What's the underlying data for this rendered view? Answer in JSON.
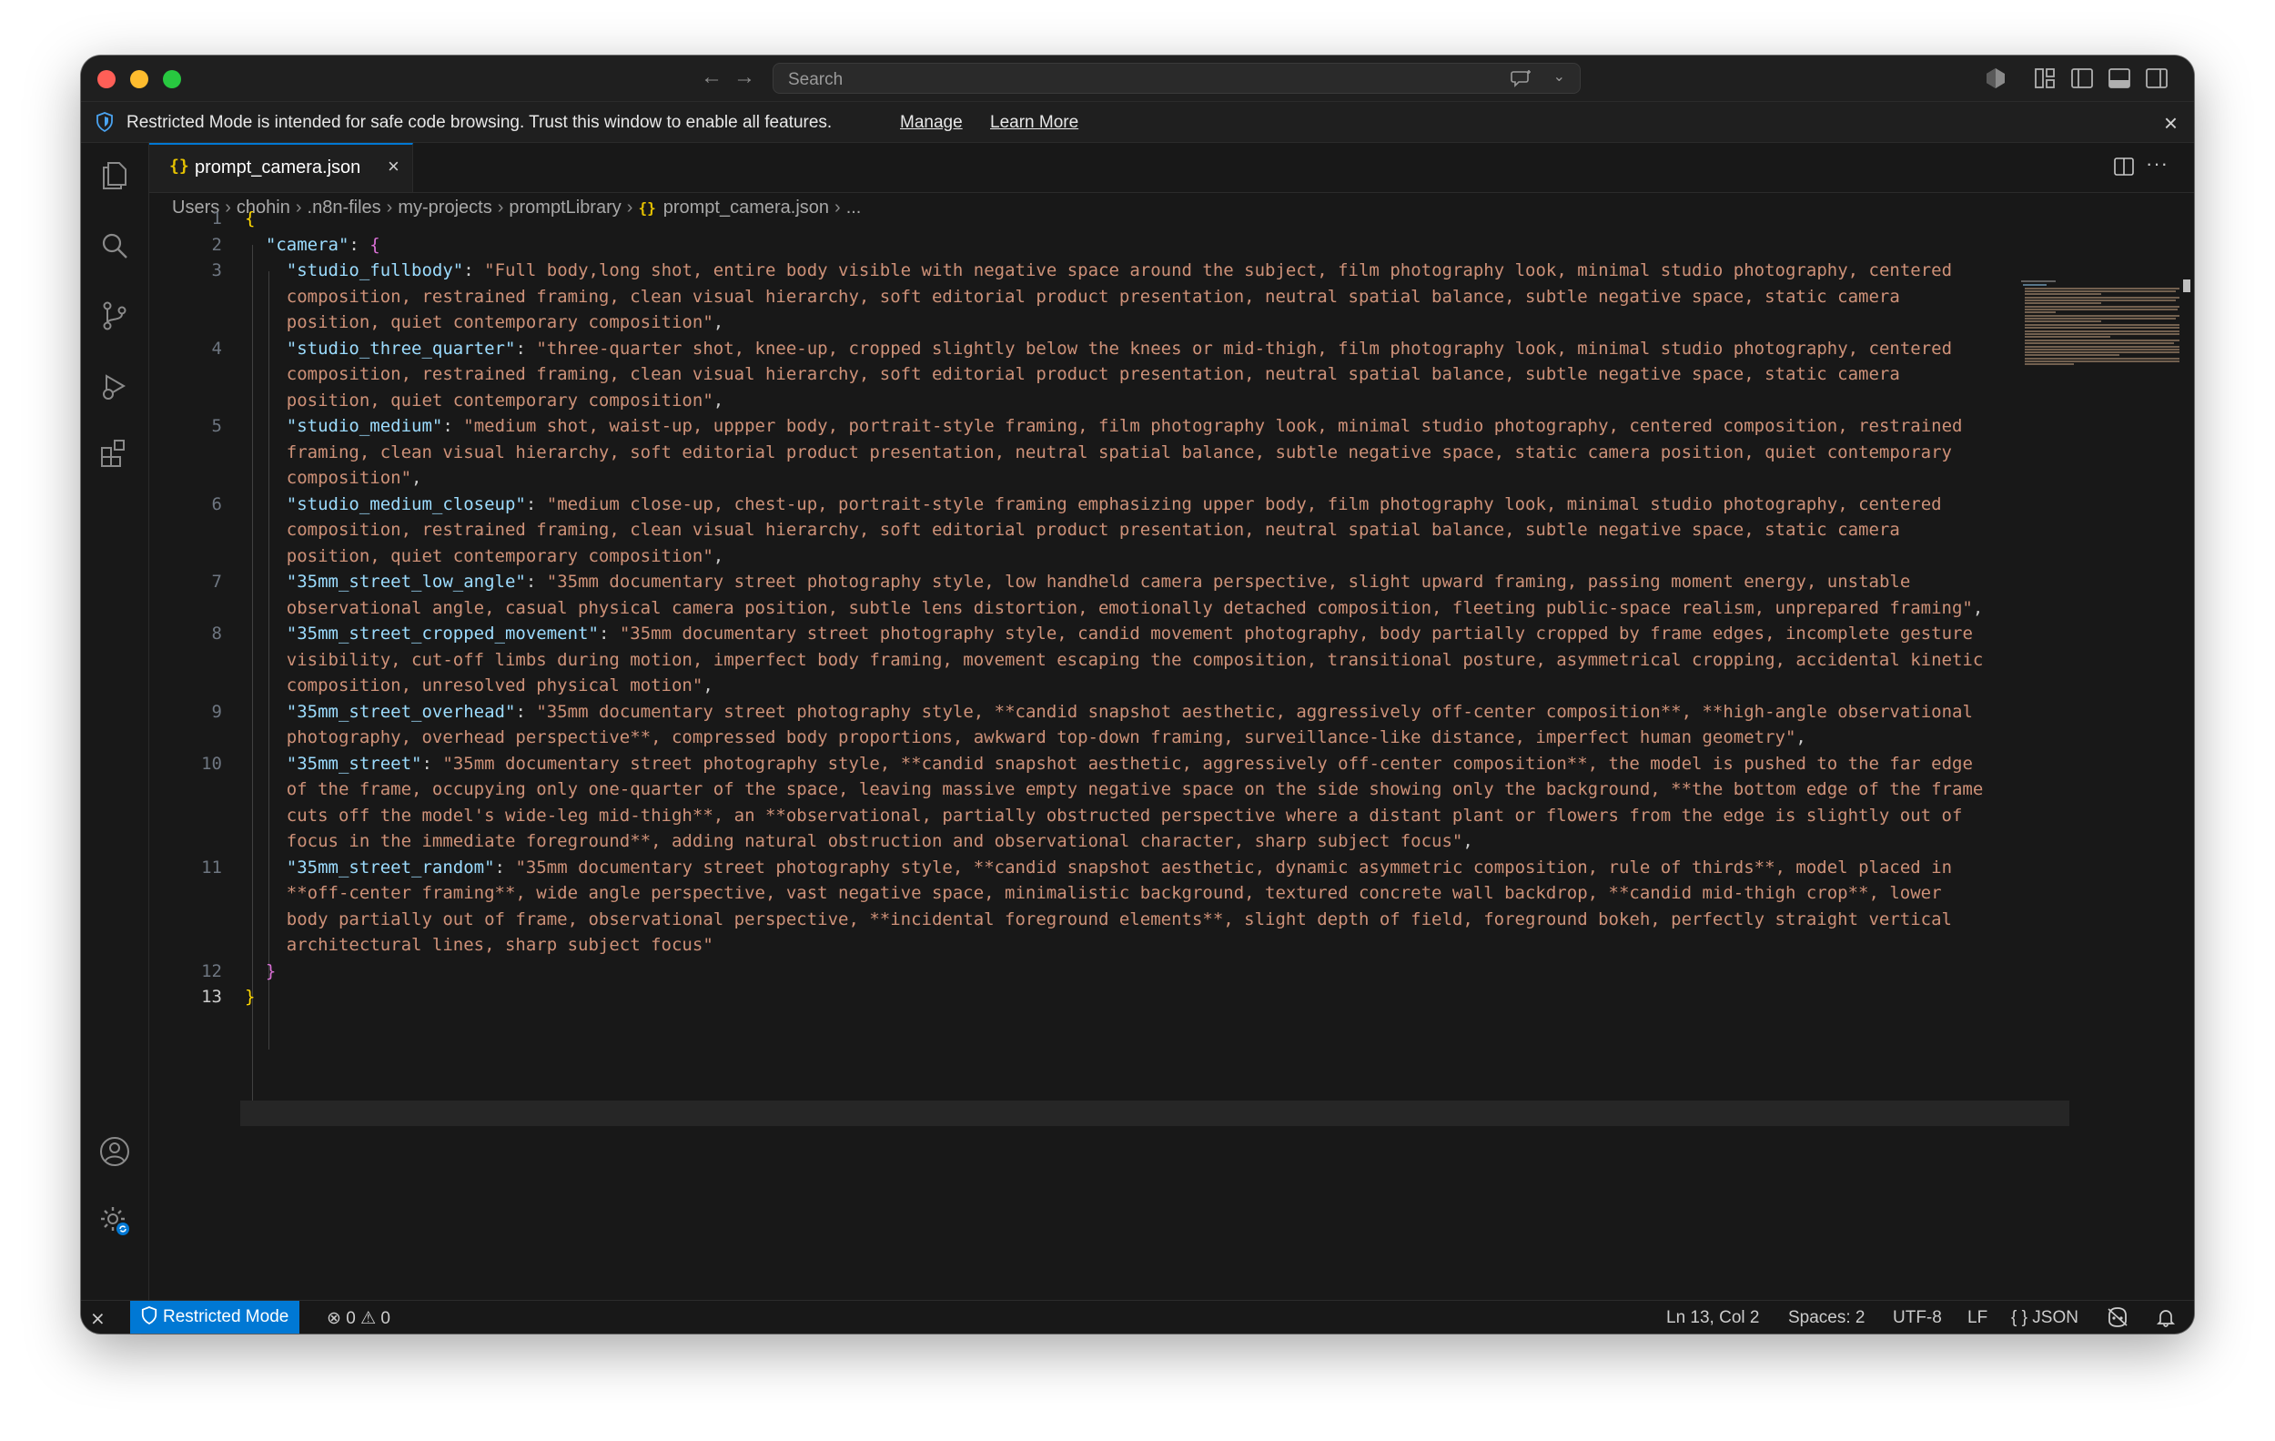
{
  "titlebar": {
    "search_placeholder": "Search"
  },
  "banner": {
    "message": "Restricted Mode is intended for safe code browsing. Trust this window to enable all features.",
    "manage_label": "Manage",
    "learn_more_label": "Learn More"
  },
  "tab": {
    "icon": "{}",
    "name": "prompt_camera.json",
    "close": "×"
  },
  "breadcrumb": {
    "items": [
      "Users",
      "chohin",
      ".n8n-files",
      "my-projects",
      "promptLibrary",
      "prompt_camera.json",
      "..."
    ],
    "json_icon": "{}"
  },
  "editor": {
    "lines": [
      {
        "n": "1",
        "text": "{"
      },
      {
        "n": "2",
        "text": "\"camera\": {"
      },
      {
        "n": "3",
        "text": "\"studio_fullbody\": \"Full body,long shot, entire body visible with negative space around the subject, film photography look, minimal studio photography, centered composition, restrained framing, clean visual hierarchy, soft editorial product presentation, neutral spatial balance, subtle negative space, static camera position, quiet contemporary composition\","
      },
      {
        "n": "4",
        "text": "\"studio_three_quarter\": \"three-quarter shot, knee-up, cropped slightly below the knees or mid-thigh, film photography look, minimal studio photography, centered composition, restrained framing, clean visual hierarchy, soft editorial product presentation, neutral spatial balance, subtle negative space, static camera position, quiet contemporary composition\","
      },
      {
        "n": "5",
        "text": "\"studio_medium\": \"medium shot, waist-up, uppper body, portrait-style framing, film photography look, minimal studio photography, centered composition, restrained framing, clean visual hierarchy, soft editorial product presentation, neutral spatial balance, subtle negative space, static camera position, quiet contemporary composition\","
      },
      {
        "n": "6",
        "text": "\"studio_medium_closeup\": \"medium close-up, chest-up, portrait-style framing emphasizing upper body, film photography look, minimal studio photography, centered composition, restrained framing, clean visual hierarchy, soft editorial product presentation, neutral spatial balance, subtle negative space, static camera position, quiet contemporary composition\","
      },
      {
        "n": "7",
        "text": "\"35mm_street_low_angle\": \"35mm documentary street photography style, low handheld camera perspective, slight upward framing, passing moment energy, unstable observational angle, casual physical camera position, subtle lens distortion, emotionally detached composition, fleeting public-space realism, unprepared framing\","
      },
      {
        "n": "8",
        "text": "\"35mm_street_cropped_movement\": \"35mm documentary street photography style, candid movement photography, body partially cropped by frame edges, incomplete gesture visibility, cut-off limbs during motion, imperfect body framing, movement escaping the composition, transitional posture, asymmetrical cropping, accidental kinetic composition, unresolved physical motion\","
      },
      {
        "n": "9",
        "text": "\"35mm_street_overhead\": \"35mm documentary street photography style, **candid snapshot aesthetic, aggressively off-center composition**, **high-angle observational photography, overhead perspective**, compressed body proportions, awkward top-down framing, surveillance-like distance, imperfect human geometry\","
      },
      {
        "n": "10",
        "text": "\"35mm_street\": \"35mm documentary street photography style, **candid snapshot aesthetic, aggressively off-center composition**, the model is pushed to the far edge of the frame, occupying only one-quarter of the space, leaving massive empty negative space on the side showing only the background, **the bottom edge of the frame cuts off the model's wide-leg mid-thigh**, an **observational, partially obstructed perspective where a distant plant or flowers from the edge is slightly out of focus in the immediate foreground**, adding natural obstruction and observational character, sharp subject focus\","
      },
      {
        "n": "11",
        "text": "\"35mm_street_random\": \"35mm documentary street photography style, **candid snapshot aesthetic, dynamic asymmetric composition, rule of thirds**, model placed in **off-center framing**, wide angle perspective, vast negative space, minimalistic background, textured concrete wall backdrop, **candid mid-thigh crop**, lower body partially out of frame, observational perspective, **incidental foreground elements**, slight depth of field, foreground bokeh, perfectly straight vertical architectural lines, sharp subject focus\""
      },
      {
        "n": "12",
        "text": "}"
      },
      {
        "n": "13",
        "text": "}"
      }
    ],
    "display": [
      {
        "ln": "1",
        "segs": [
          {
            "c": "br1",
            "t": "{"
          }
        ]
      },
      {
        "ln": "2",
        "segs": [
          {
            "c": "p",
            "t": "  "
          },
          {
            "c": "k",
            "t": "\"camera\""
          },
          {
            "c": "p",
            "t": ": "
          },
          {
            "c": "br2",
            "t": "{"
          }
        ]
      },
      {
        "ln": "3",
        "segs": [
          {
            "c": "p",
            "t": "    "
          },
          {
            "c": "k",
            "t": "\"studio_fullbody\""
          },
          {
            "c": "p",
            "t": ": "
          },
          {
            "c": "s",
            "t": "\"Full body,long shot, entire body visible with negative space around the subject, film photography look, minimal studio photography, centered"
          }
        ]
      },
      {
        "ln": "",
        "segs": [
          {
            "c": "s",
            "t": "    composition, restrained framing, clean visual hierarchy, soft editorial product presentation, neutral spatial balance, subtle negative space, static camera"
          }
        ]
      },
      {
        "ln": "",
        "segs": [
          {
            "c": "s",
            "t": "    position, quiet contemporary composition\""
          },
          {
            "c": "p",
            "t": ","
          }
        ]
      },
      {
        "ln": "4",
        "segs": [
          {
            "c": "p",
            "t": "    "
          },
          {
            "c": "k",
            "t": "\"studio_three_quarter\""
          },
          {
            "c": "p",
            "t": ": "
          },
          {
            "c": "s",
            "t": "\"three-quarter shot, knee-up, cropped slightly below the knees or mid-thigh, film photography look, minimal studio photography, centered"
          }
        ]
      },
      {
        "ln": "",
        "segs": [
          {
            "c": "s",
            "t": "    composition, restrained framing, clean visual hierarchy, soft editorial product presentation, neutral spatial balance, subtle negative space, static camera"
          }
        ]
      },
      {
        "ln": "",
        "segs": [
          {
            "c": "s",
            "t": "    position, quiet contemporary composition\""
          },
          {
            "c": "p",
            "t": ","
          }
        ]
      },
      {
        "ln": "5",
        "segs": [
          {
            "c": "p",
            "t": "    "
          },
          {
            "c": "k",
            "t": "\"studio_medium\""
          },
          {
            "c": "p",
            "t": ": "
          },
          {
            "c": "s",
            "t": "\"medium shot, waist-up, uppper body, portrait-style framing, film photography look, minimal studio photography, centered composition, restrained"
          }
        ]
      },
      {
        "ln": "",
        "segs": [
          {
            "c": "s",
            "t": "    framing, clean visual hierarchy, soft editorial product presentation, neutral spatial balance, subtle negative space, static camera position, quiet contemporary"
          }
        ]
      },
      {
        "ln": "",
        "segs": [
          {
            "c": "s",
            "t": "    composition\""
          },
          {
            "c": "p",
            "t": ","
          }
        ]
      },
      {
        "ln": "6",
        "segs": [
          {
            "c": "p",
            "t": "    "
          },
          {
            "c": "k",
            "t": "\"studio_medium_closeup\""
          },
          {
            "c": "p",
            "t": ": "
          },
          {
            "c": "s",
            "t": "\"medium close-up, chest-up, portrait-style framing emphasizing upper body, film photography look, minimal studio photography, centered"
          }
        ]
      },
      {
        "ln": "",
        "segs": [
          {
            "c": "s",
            "t": "    composition, restrained framing, clean visual hierarchy, soft editorial product presentation, neutral spatial balance, subtle negative space, static camera"
          }
        ]
      },
      {
        "ln": "",
        "segs": [
          {
            "c": "s",
            "t": "    position, quiet contemporary composition\""
          },
          {
            "c": "p",
            "t": ","
          }
        ]
      },
      {
        "ln": "7",
        "segs": [
          {
            "c": "p",
            "t": "    "
          },
          {
            "c": "k",
            "t": "\"35mm_street_low_angle\""
          },
          {
            "c": "p",
            "t": ": "
          },
          {
            "c": "s",
            "t": "\"35mm documentary street photography style, low handheld camera perspective, slight upward framing, passing moment energy, unstable"
          }
        ]
      },
      {
        "ln": "",
        "segs": [
          {
            "c": "s",
            "t": "    observational angle, casual physical camera position, subtle lens distortion, emotionally detached composition, fleeting public-space realism, unprepared framing\""
          },
          {
            "c": "p",
            "t": ","
          }
        ]
      },
      {
        "ln": "8",
        "segs": [
          {
            "c": "p",
            "t": "    "
          },
          {
            "c": "k",
            "t": "\"35mm_street_cropped_movement\""
          },
          {
            "c": "p",
            "t": ": "
          },
          {
            "c": "s",
            "t": "\"35mm documentary street photography style, candid movement photography, body partially cropped by frame edges, incomplete gesture"
          }
        ]
      },
      {
        "ln": "",
        "segs": [
          {
            "c": "s",
            "t": "    visibility, cut-off limbs during motion, imperfect body framing, movement escaping the composition, transitional posture, asymmetrical cropping, accidental kinetic"
          }
        ]
      },
      {
        "ln": "",
        "segs": [
          {
            "c": "s",
            "t": "    composition, unresolved physical motion\""
          },
          {
            "c": "p",
            "t": ","
          }
        ]
      },
      {
        "ln": "9",
        "segs": [
          {
            "c": "p",
            "t": "    "
          },
          {
            "c": "k",
            "t": "\"35mm_street_overhead\""
          },
          {
            "c": "p",
            "t": ": "
          },
          {
            "c": "s",
            "t": "\"35mm documentary street photography style, **candid snapshot aesthetic, aggressively off-center composition**, **high-angle observational"
          }
        ]
      },
      {
        "ln": "",
        "segs": [
          {
            "c": "s",
            "t": "    photography, overhead perspective**, compressed body proportions, awkward top-down framing, surveillance-like distance, imperfect human geometry\""
          },
          {
            "c": "p",
            "t": ","
          }
        ]
      },
      {
        "ln": "10",
        "segs": [
          {
            "c": "p",
            "t": "    "
          },
          {
            "c": "k",
            "t": "\"35mm_street\""
          },
          {
            "c": "p",
            "t": ": "
          },
          {
            "c": "s",
            "t": "\"35mm documentary street photography style, **candid snapshot aesthetic, aggressively off-center composition**, the model is pushed to the far edge"
          }
        ]
      },
      {
        "ln": "",
        "segs": [
          {
            "c": "s",
            "t": "    of the frame, occupying only one-quarter of the space, leaving massive empty negative space on the side showing only the background, **the bottom edge of the frame"
          }
        ]
      },
      {
        "ln": "",
        "segs": [
          {
            "c": "s",
            "t": "    cuts off the model's wide-leg mid-thigh**, an **observational, partially obstructed perspective where a distant plant or flowers from the edge is slightly out of"
          }
        ]
      },
      {
        "ln": "",
        "segs": [
          {
            "c": "s",
            "t": "    focus in the immediate foreground**, adding natural obstruction and observational character, sharp subject focus\""
          },
          {
            "c": "p",
            "t": ","
          }
        ]
      },
      {
        "ln": "11",
        "segs": [
          {
            "c": "p",
            "t": "    "
          },
          {
            "c": "k",
            "t": "\"35mm_street_random\""
          },
          {
            "c": "p",
            "t": ": "
          },
          {
            "c": "s",
            "t": "\"35mm documentary street photography style, **candid snapshot aesthetic, dynamic asymmetric composition, rule of thirds**, model placed in"
          }
        ]
      },
      {
        "ln": "",
        "segs": [
          {
            "c": "s",
            "t": "    **off-center framing**, wide angle perspective, vast negative space, minimalistic background, textured concrete wall backdrop, **candid mid-thigh crop**, lower"
          }
        ]
      },
      {
        "ln": "",
        "segs": [
          {
            "c": "s",
            "t": "    body partially out of frame, observational perspective, **incidental foreground elements**, slight depth of field, foreground bokeh, perfectly straight vertical"
          }
        ]
      },
      {
        "ln": "",
        "segs": [
          {
            "c": "s",
            "t": "    architectural lines, sharp subject focus\""
          }
        ]
      },
      {
        "ln": "12",
        "segs": [
          {
            "c": "p",
            "t": "  "
          },
          {
            "c": "br2",
            "t": "}"
          }
        ]
      },
      {
        "ln": "13",
        "segs": [
          {
            "c": "br1",
            "t": "}"
          }
        ]
      }
    ]
  },
  "statusbar": {
    "restricted_mode": "Restricted Mode",
    "errors": "0",
    "warnings": "0",
    "cursor": "Ln 13, Col 2",
    "spaces": "Spaces: 2",
    "encoding": "UTF-8",
    "eol": "LF",
    "language_icon": "{ }",
    "language": "JSON"
  },
  "colors": {
    "accent": "#0078d4",
    "json_key": "#9cdcfe",
    "json_string": "#ce9178",
    "bracket_1": "#ffd700",
    "bracket_2": "#da70d6"
  },
  "icons": {
    "activity_bar": [
      "explorer-icon",
      "search-icon",
      "source-control-icon",
      "run-debug-icon",
      "extensions-icon",
      "account-icon",
      "manage-gear-icon"
    ],
    "titlebar": [
      "back-arrow-icon",
      "forward-arrow-icon",
      "chat-icon",
      "copilot-icon",
      "customize-layout-icon",
      "toggle-sidebar-icon",
      "toggle-panel-icon",
      "toggle-secondary-sidebar-icon"
    ]
  }
}
